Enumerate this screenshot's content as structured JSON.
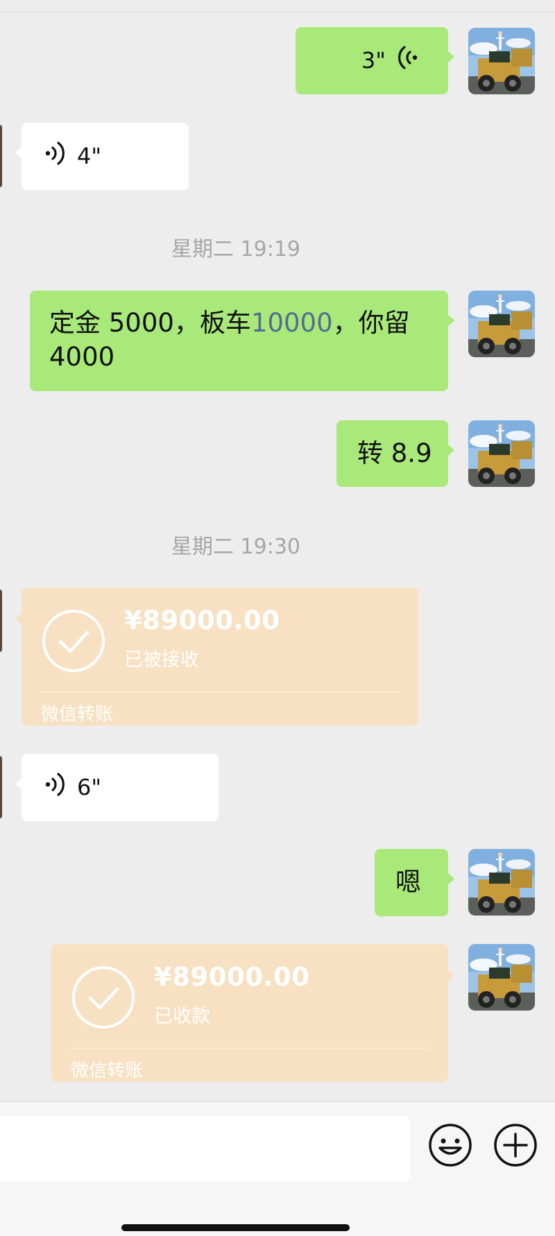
{
  "messages": {
    "m1": {
      "duration": "3\""
    },
    "m2": {
      "duration": "4\""
    },
    "ts1": "星期二 19:19",
    "m3": {
      "part1": "定金 5000，板车",
      "link": "10000",
      "part2": "，你留",
      "line2": "4000"
    },
    "m4": {
      "text": "转 8.9"
    },
    "ts2": "星期二 19:30",
    "m5": {
      "amount": "¥89000.00",
      "status": "已被接收",
      "footer": "微信转账"
    },
    "m6": {
      "duration": "6\""
    },
    "m7": {
      "text": "嗯"
    },
    "m8": {
      "amount": "¥89000.00",
      "status": "已收款",
      "footer": "微信转账"
    }
  },
  "icons": {
    "voice": "voice-wave-icon",
    "transfer_done": "check-circle-icon",
    "emoji": "emoji-icon",
    "more": "plus-circle-icon"
  },
  "colors": {
    "background": "#ededed",
    "sent_bubble": "#a9e97a",
    "received_bubble": "#ffffff",
    "transfer_card": "#f7e1c2",
    "link": "#566b94",
    "timestamp": "#a6a6a6"
  }
}
